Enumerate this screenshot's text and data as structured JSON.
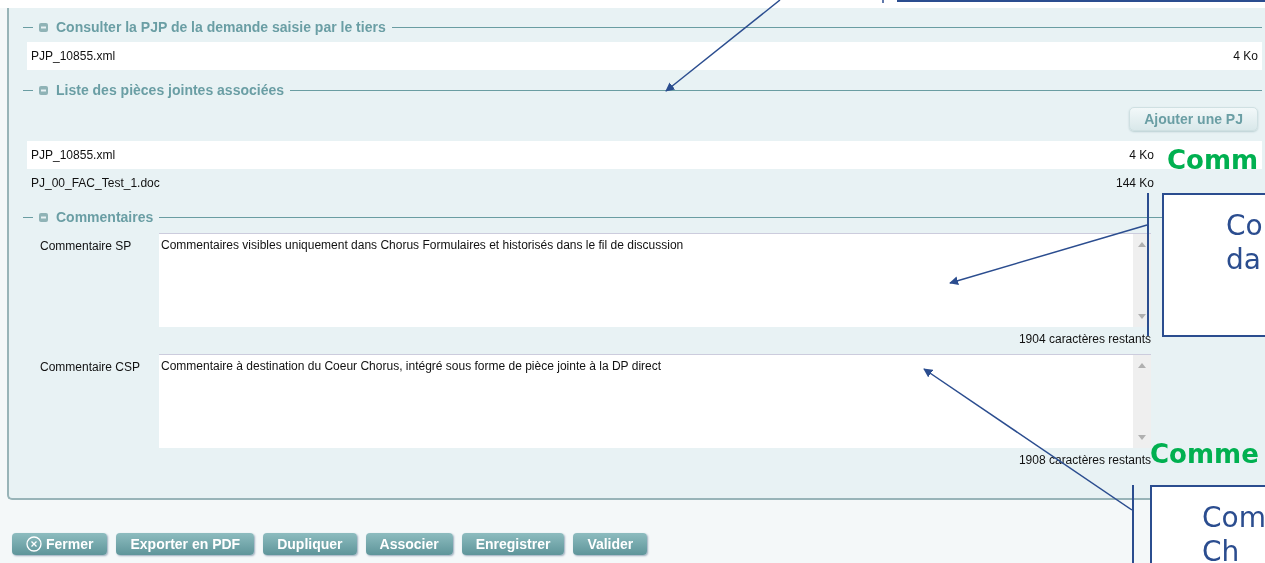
{
  "sections": [
    {
      "legend": "Consulter la PJP de la demande saisie par le tiers",
      "expanded": true,
      "files": [
        {
          "name": "PJP_10855.xml",
          "size": "4 Ko"
        }
      ]
    },
    {
      "legend": "Liste des pièces jointes associées",
      "expanded": true,
      "add_button": "Ajouter une PJ",
      "files": [
        {
          "name": "PJP_10855.xml",
          "size": "4 Ko"
        },
        {
          "name": "PJ_00_FAC_Test_1.doc",
          "size": "144 Ko"
        }
      ]
    },
    {
      "legend": "Commentaires",
      "expanded": true,
      "comments": [
        {
          "label": "Commentaire SP",
          "value": "Commentaires visibles uniquement dans Chorus Formulaires et historisés dans le fil de discussion",
          "remaining": "1904 caractères restants"
        },
        {
          "label": "Commentaire CSP",
          "value": "Commentaire à destination du Coeur Chorus, intégré sous forme de pièce jointe à la DP direct",
          "remaining": "1908 caractères restants"
        }
      ]
    }
  ],
  "buttons": [
    {
      "label": "Fermer",
      "kind": "close"
    },
    {
      "label": "Exporter en PDF"
    },
    {
      "label": "Dupliquer"
    },
    {
      "label": "Associer"
    },
    {
      "label": "Enregistrer"
    },
    {
      "label": "Valider"
    }
  ],
  "callouts": [
    {
      "heading": "Comm",
      "lines": [
        "Co",
        "da"
      ]
    },
    {
      "heading": "Comme",
      "lines": [
        "Com",
        "Ch"
      ]
    }
  ]
}
